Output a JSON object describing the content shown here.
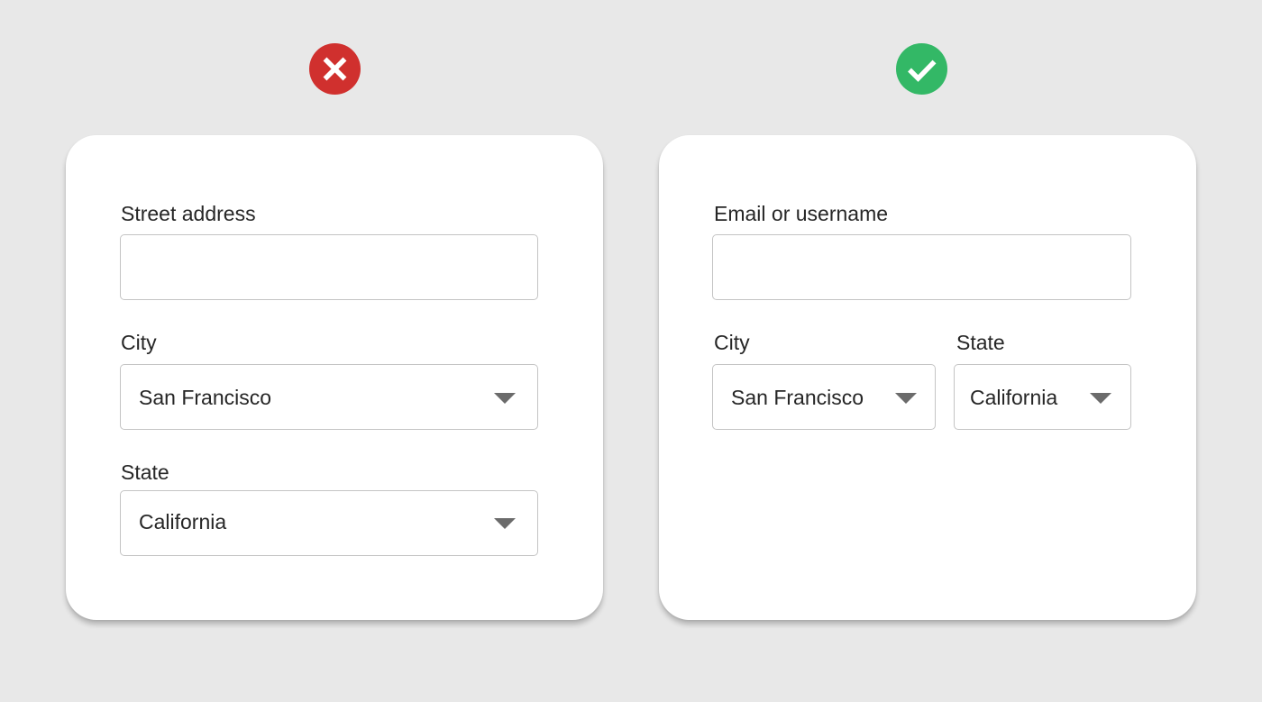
{
  "examples": {
    "bad": {
      "icon": "close-icon",
      "color": "#d0302e",
      "street_label": "Street address",
      "street_value": "",
      "city_label": "City",
      "city_value": "San Francisco",
      "state_label": "State",
      "state_value": "California"
    },
    "good": {
      "icon": "checkmark-icon",
      "color": "#33b866",
      "email_label": "Email or username",
      "email_value": "",
      "city_label": "City",
      "city_value": "San Francisco",
      "state_label": "State",
      "state_value": "California"
    }
  },
  "colors": {
    "background": "#e8e8e8",
    "card": "#ffffff",
    "field_border": "#c4c4c4",
    "text": "#262626",
    "caret": "#6b6b6b"
  }
}
